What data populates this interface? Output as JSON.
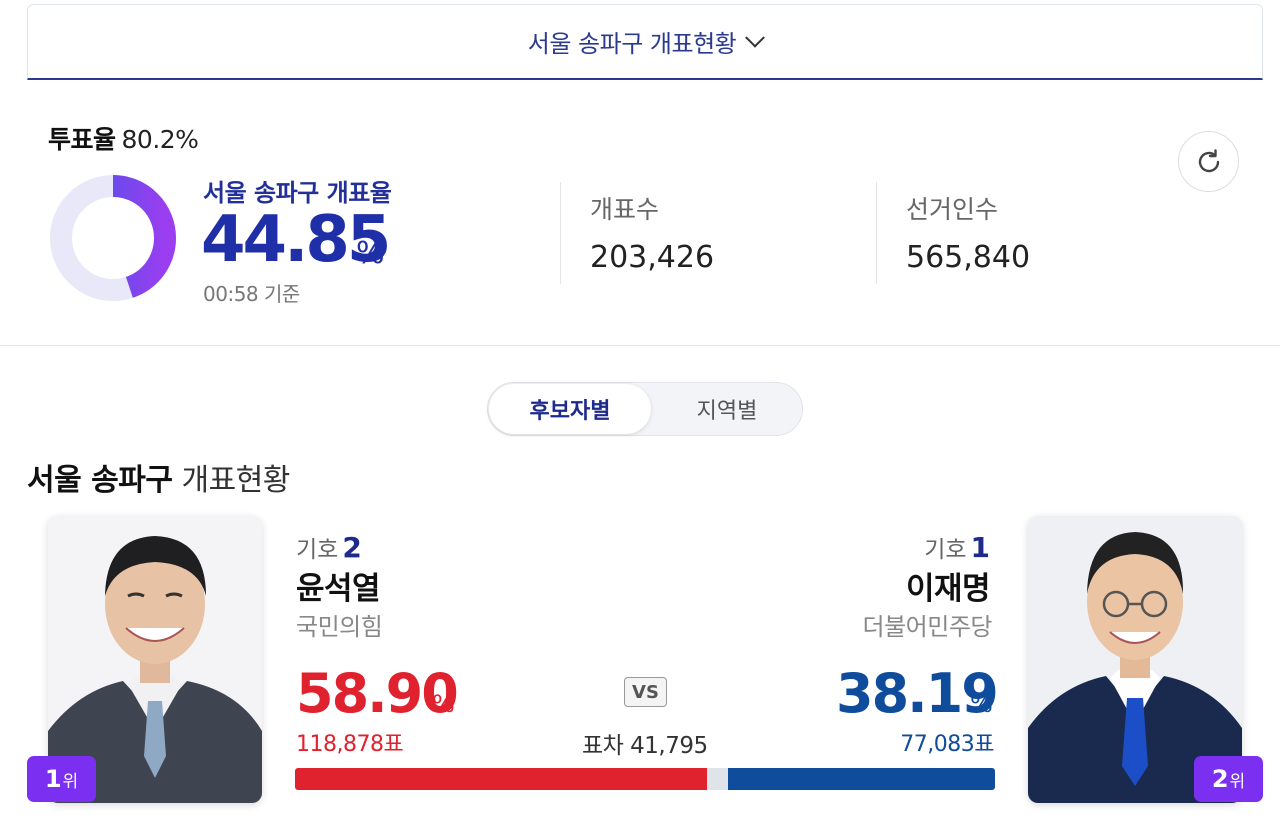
{
  "region_selector": {
    "label": "서울 송파구 개표현황"
  },
  "summary": {
    "turnout_label": "투표율",
    "turnout_value": "80.2%",
    "count_label": "서울 송파구 개표율",
    "count_percent": "44.85",
    "count_percent_value": 44.85,
    "count_unit": "%",
    "time": "00:58 기준",
    "counted_label": "개표수",
    "counted_value": "203,426",
    "electorate_label": "선거인수",
    "electorate_value": "565,840"
  },
  "tabs": [
    {
      "label": "후보자별",
      "active": true
    },
    {
      "label": "지역별",
      "active": false
    }
  ],
  "section": {
    "title_bold": "서울 송파구",
    "title_light": "개표현황"
  },
  "candidates": [
    {
      "rank": "1",
      "rank_suffix": "위",
      "ballot_label": "기호",
      "ballot_number": "2",
      "name": "윤석열",
      "party": "국민의힘",
      "percent": "58.90",
      "percent_unit": "%",
      "share": 58.9,
      "votes": "118,878표",
      "color": "#e0212e",
      "tie_color": "#9fb4d6"
    },
    {
      "rank": "2",
      "rank_suffix": "위",
      "ballot_label": "기호",
      "ballot_number": "1",
      "name": "이재명",
      "party": "더불어민주당",
      "percent": "38.19",
      "percent_unit": "%",
      "share": 38.19,
      "votes": "77,083표",
      "color": "#104c9c",
      "tie_color": "#1b5bd6"
    }
  ],
  "versus": {
    "badge": "VS",
    "margin": "표차 41,795"
  },
  "colors": {
    "accent": "#1f2fa8",
    "rank_badge": "#7b2ff0",
    "donut_track": "#e8e8f8",
    "donut_start": "#3a55e6",
    "donut_end": "#9b3ef0"
  }
}
